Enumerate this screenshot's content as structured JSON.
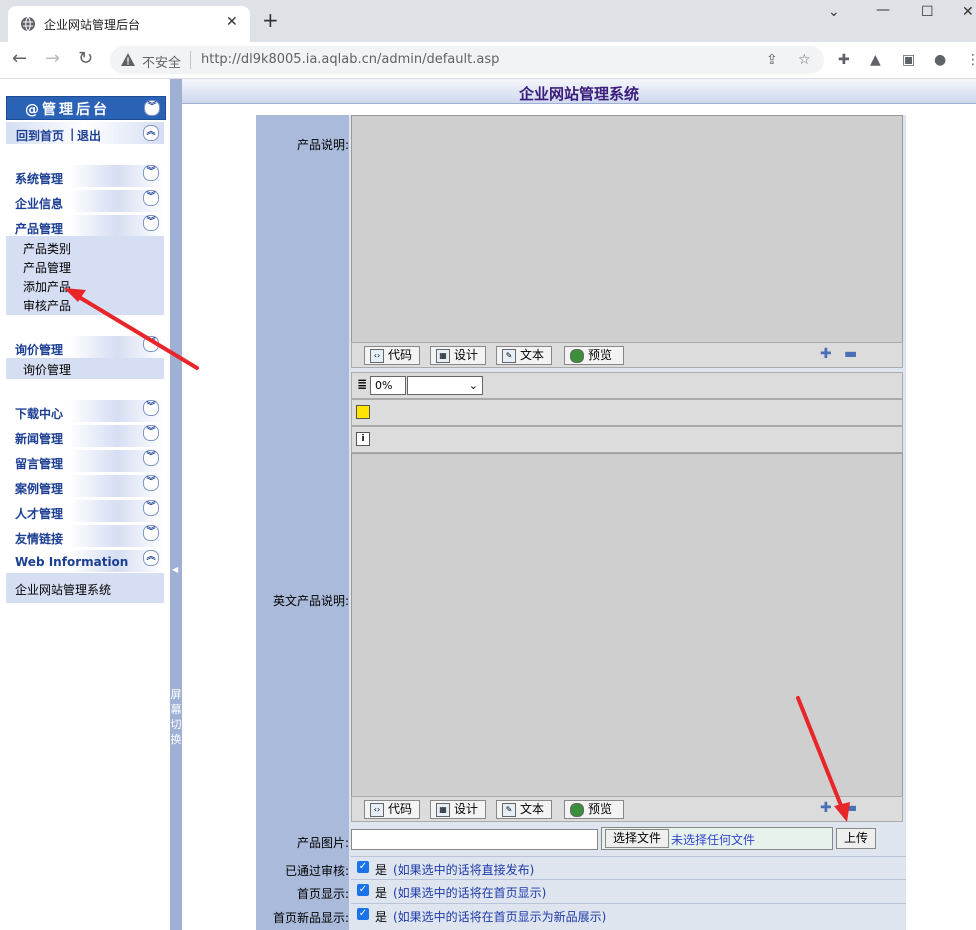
{
  "browser": {
    "tab_title": "企业网站管理后台",
    "insecure_label": "不安全",
    "url": "http://dl9k8005.ia.aqlab.cn/admin/default.asp"
  },
  "sidebar": {
    "header": "@管理后台",
    "home_link": "回到首页",
    "link_sep": "|",
    "logout_link": "退出",
    "menus": [
      {
        "label": "系统管理"
      },
      {
        "label": "企业信息"
      },
      {
        "label": "产品管理",
        "items": [
          "产品类别",
          "产品管理",
          "添加产品",
          "审核产品"
        ]
      },
      {
        "label": "询价管理",
        "items": [
          "询价管理"
        ]
      },
      {
        "label": "下载中心"
      },
      {
        "label": "新闻管理"
      },
      {
        "label": "留言管理"
      },
      {
        "label": "案例管理"
      },
      {
        "label": "人才管理"
      },
      {
        "label": "友情链接"
      },
      {
        "label": "Web Information"
      }
    ],
    "web_info_text": "企业网站管理系统",
    "splitter_text": "屏幕切换"
  },
  "main": {
    "title": "企业网站管理系统",
    "fields": {
      "desc_label": "产品说明:",
      "en_desc_label": "英文产品说明:",
      "image_label": "产品图片:",
      "audit_label": "已通过审核:",
      "home_label": "首页显示:",
      "home_new_label": "首页新品显示:"
    },
    "editor_modes": [
      "代码",
      "设计",
      "文本",
      "预览"
    ],
    "zoom_select": "0%",
    "file": {
      "choose_button": "选择文件",
      "no_file": "未选择任何文件",
      "upload_button": "上传"
    },
    "checkboxes": [
      {
        "yes": "是",
        "hint": "(如果选中的话将直接发布)",
        "checked": true
      },
      {
        "yes": "是",
        "hint": "(如果选中的话将在首页显示)",
        "checked": true
      },
      {
        "yes": "是",
        "hint": "(如果选中的话将在首页显示为新品展示)",
        "checked": true
      }
    ]
  },
  "colors": {
    "accent": "#2a63b5",
    "label_column": "#aabada",
    "annotation_arrow": "#e8262a"
  }
}
